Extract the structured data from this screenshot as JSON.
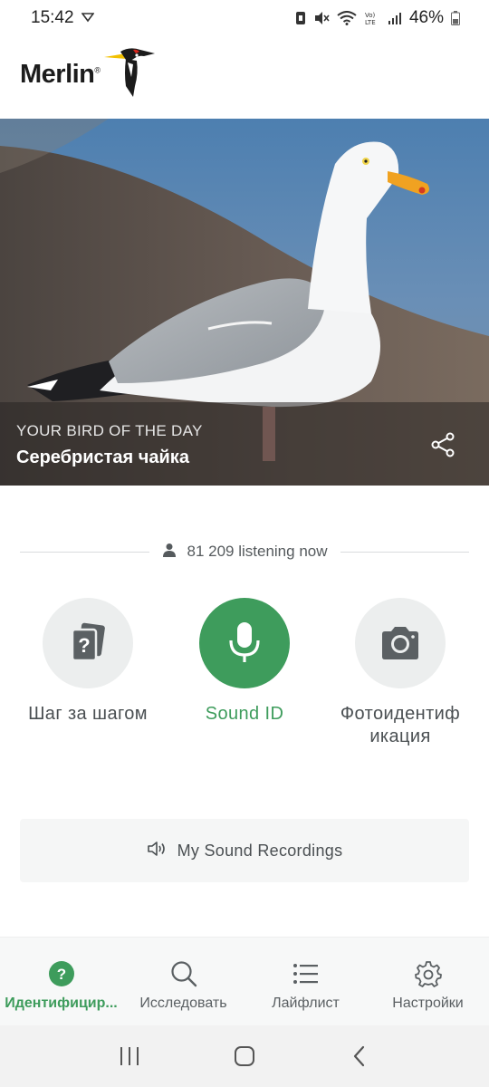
{
  "status_bar": {
    "time": "15:42",
    "battery_percent": "46%",
    "icons": [
      "cast-icon",
      "nfc-icon",
      "mute-icon",
      "wifi-icon",
      "volte-icon",
      "signal-icon",
      "battery-icon"
    ]
  },
  "header": {
    "app_name": "Merlin",
    "reg_mark": "®"
  },
  "hero": {
    "kicker": "YOUR BIRD OF THE DAY",
    "bird_name": "Серебристая чайка"
  },
  "listening": {
    "count_text": "81 209 listening now"
  },
  "id_options": [
    {
      "label": "Шаг за шагом",
      "icon": "question-cards-icon"
    },
    {
      "label": "Sound ID",
      "icon": "microphone-icon"
    },
    {
      "label": "Фотоидентиф\nикация",
      "icon": "camera-icon"
    }
  ],
  "id_option_labels": {
    "step": "Шаг за шагом",
    "sound": "Sound ID",
    "photo_line1": "Фотоидентиф",
    "photo_line2": "икация"
  },
  "recordings": {
    "label": "My Sound Recordings"
  },
  "bottom_nav": {
    "identify": "Идентифицир...",
    "explore": "Исследовать",
    "lifelist": "Лайфлист",
    "settings": "Настройки"
  },
  "colors": {
    "accent": "#3e9c5c",
    "neutral_circle": "#eceeee",
    "text": "#4a4f52"
  }
}
